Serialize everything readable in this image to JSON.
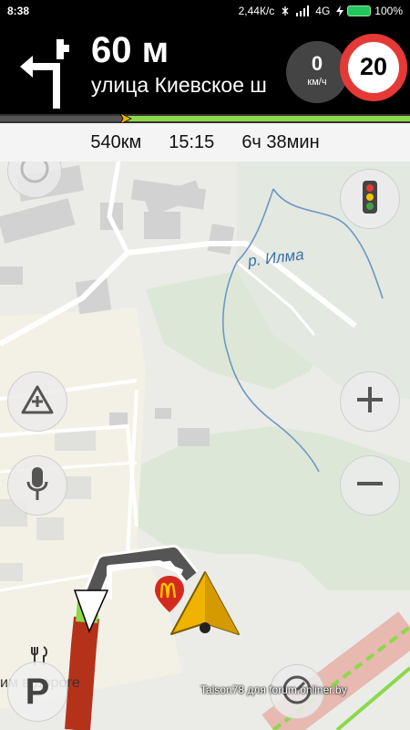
{
  "status": {
    "time": "8:38",
    "net_speed": "2,44К/с",
    "network": "4G",
    "battery": "100%"
  },
  "nav": {
    "distance": "60 м",
    "street": "улица Киевское ш",
    "speed_value": "0",
    "speed_unit": "км/ч",
    "speed_limit": "20"
  },
  "trip": {
    "remaining_distance": "540км",
    "arrival_time": "15:15",
    "duration": "6ч 38мин"
  },
  "map": {
    "river_label": "р. Илма",
    "road_label": "им в дороге",
    "parking_letter": "P",
    "watermark": "Talson78 для forum.onliner.by"
  },
  "icons": {
    "turn": "turn-left-arrow-icon",
    "compass": "compass-icon",
    "traffic": "traffic-light-icon",
    "report": "road-event-icon",
    "voice": "microphone-icon",
    "zoom_in": "plus-icon",
    "zoom_out": "minus-icon",
    "food": "fork-knife-icon",
    "cursor": "navigation-arrow-icon",
    "poi": "mcdonalds-icon"
  },
  "colors": {
    "route_green": "#8bd94a",
    "route_red": "#b5321a",
    "limit_red": "#e53935",
    "cursor_yellow": "#f0b400"
  }
}
